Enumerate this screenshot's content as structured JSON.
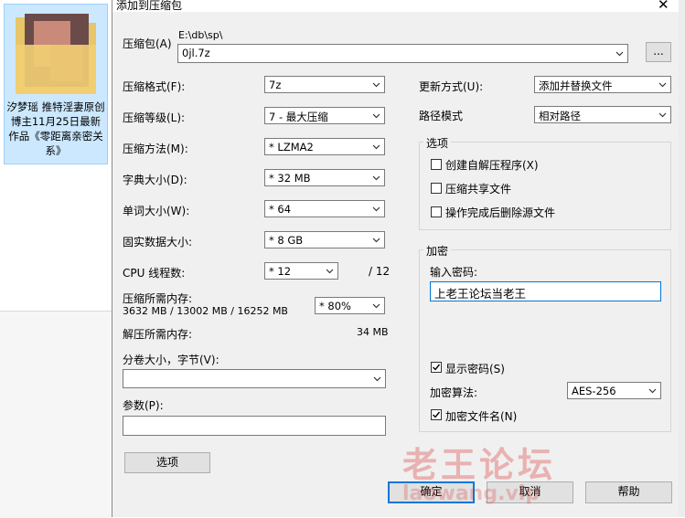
{
  "background": {
    "file_name": "汐梦瑶 推特淫妻原创博主11月25日最新作品《零距离亲密关系》"
  },
  "dialog": {
    "title": "添加到压缩包",
    "archive_label": "压缩包(A)",
    "archive_path": "E:\\db\\sp\\",
    "archive_name": "0jl.7z",
    "browse_label": "...",
    "format_label": "压缩格式(F):",
    "format_value": "7z",
    "level_label": "压缩等级(L):",
    "level_value": "7 - 最大压缩",
    "method_label": "压缩方法(M):",
    "method_value": "* LZMA2",
    "dict_label": "字典大小(D):",
    "dict_value": "* 32 MB",
    "word_label": "单词大小(W):",
    "word_value": "* 64",
    "solid_label": "固实数据大小:",
    "solid_value": "* 8 GB",
    "cpu_label": "CPU 线程数:",
    "cpu_value": "* 12",
    "cpu_total": "/ 12",
    "mem_comp_label": "压缩所需内存:",
    "mem_comp_value": "3632 MB / 13002 MB / 16252 MB",
    "mem_percent": "* 80%",
    "mem_decomp_label": "解压所需内存:",
    "mem_decomp_value": "34 MB",
    "volume_label": "分卷大小，字节(V):",
    "volume_value": "",
    "params_label": "参数(P):",
    "params_value": "",
    "options_button": "选项",
    "update_label": "更新方式(U):",
    "update_value": "添加并替换文件",
    "pathmode_label": "路径模式",
    "pathmode_value": "相对路径",
    "options_group": "选项",
    "opt_sfx": "创建自解压程序(X)",
    "opt_shared": "压缩共享文件",
    "opt_delete": "操作完成后删除源文件",
    "encrypt_group": "加密",
    "password_label": "输入密码:",
    "password_value": "上老王论坛当老王",
    "show_password": "显示密码(S)",
    "enc_method_label": "加密算法:",
    "enc_method_value": "AES-256",
    "enc_names": "加密文件名(N)",
    "ok": "确定",
    "cancel": "取消",
    "help": "帮助",
    "watermark_cn": "老王论坛",
    "watermark_en": "laowang.vip"
  },
  "colors": {
    "accent": "#0078d7",
    "dialog_bg": "#f0f0f0",
    "selection": "#cce8ff"
  }
}
